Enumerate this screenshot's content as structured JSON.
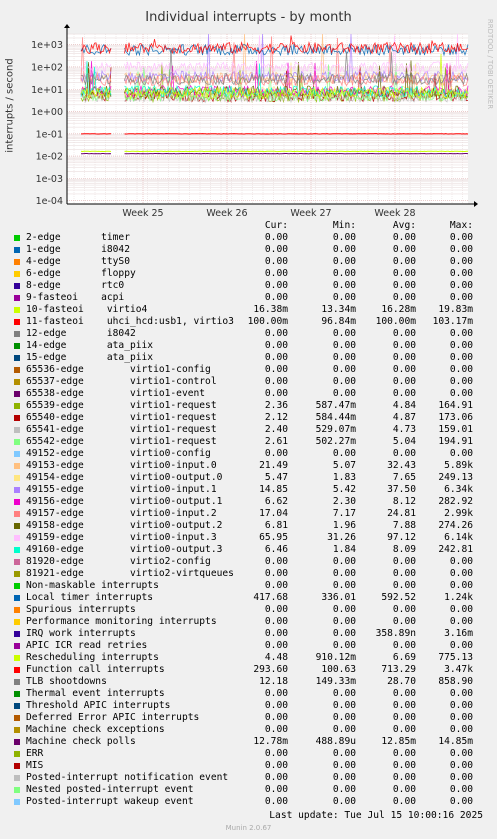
{
  "chart_data": {
    "type": "line",
    "title": "Individual interrupts - by month",
    "ylabel": "interrupts / second",
    "y_scale": "log",
    "ylim": [
      0.0001,
      3000
    ],
    "y_ticks": [
      "1e+03",
      "1e+02",
      "1e+01",
      "1e+00",
      "1e-01",
      "1e-02",
      "1e-03",
      "1e-04"
    ],
    "x_ticks": [
      "Week 25",
      "Week 26",
      "Week 27",
      "Week 28"
    ],
    "grid": true,
    "columns": [
      "Cur:",
      "Min:",
      "Avg:",
      "Max:"
    ],
    "series": [
      {
        "name": "2-edge       timer",
        "color": "#00cc00",
        "cur": "0.00",
        "min": "0.00",
        "avg": "0.00",
        "max": "0.00"
      },
      {
        "name": "1-edge       i8042",
        "color": "#0066b3",
        "cur": "0.00",
        "min": "0.00",
        "avg": "0.00",
        "max": "0.00"
      },
      {
        "name": "4-edge       ttyS0",
        "color": "#ff8000",
        "cur": "0.00",
        "min": "0.00",
        "avg": "0.00",
        "max": "0.00"
      },
      {
        "name": "6-edge       floppy",
        "color": "#ffcc00",
        "cur": "0.00",
        "min": "0.00",
        "avg": "0.00",
        "max": "0.00"
      },
      {
        "name": "8-edge       rtc0",
        "color": "#330099",
        "cur": "0.00",
        "min": "0.00",
        "avg": "0.00",
        "max": "0.00"
      },
      {
        "name": "9-fasteoi    acpi",
        "color": "#990099",
        "cur": "0.00",
        "min": "0.00",
        "avg": "0.00",
        "max": "0.00"
      },
      {
        "name": "10-fasteoi    virtio4",
        "color": "#ccff00",
        "cur": "16.38m",
        "min": "13.34m",
        "avg": "16.28m",
        "max": "19.83m"
      },
      {
        "name": "11-fasteoi    uhci_hcd:usb1, virtio3",
        "color": "#ff0000",
        "cur": "100.00m",
        "min": "96.84m",
        "avg": "100.00m",
        "max": "103.17m"
      },
      {
        "name": "12-edge       i8042",
        "color": "#808080",
        "cur": "0.00",
        "min": "0.00",
        "avg": "0.00",
        "max": "0.00"
      },
      {
        "name": "14-edge       ata_piix",
        "color": "#008f00",
        "cur": "0.00",
        "min": "0.00",
        "avg": "0.00",
        "max": "0.00"
      },
      {
        "name": "15-edge       ata_piix",
        "color": "#00487d",
        "cur": "0.00",
        "min": "0.00",
        "avg": "0.00",
        "max": "0.00"
      },
      {
        "name": "65536-edge        virtio1-config",
        "color": "#b35a00",
        "cur": "0.00",
        "min": "0.00",
        "avg": "0.00",
        "max": "0.00"
      },
      {
        "name": "65537-edge        virtio1-control",
        "color": "#b38f00",
        "cur": "0.00",
        "min": "0.00",
        "avg": "0.00",
        "max": "0.00"
      },
      {
        "name": "65538-edge        virtio1-event",
        "color": "#6b006b",
        "cur": "0.00",
        "min": "0.00",
        "avg": "0.00",
        "max": "0.00"
      },
      {
        "name": "65539-edge        virtio1-request",
        "color": "#8fb300",
        "cur": "2.36",
        "min": "587.47m",
        "avg": "4.84",
        "max": "164.91"
      },
      {
        "name": "65540-edge        virtio1-request",
        "color": "#b30000",
        "cur": "2.12",
        "min": "584.44m",
        "avg": "4.87",
        "max": "173.06"
      },
      {
        "name": "65541-edge        virtio1-request",
        "color": "#bebebe",
        "cur": "2.40",
        "min": "529.07m",
        "avg": "4.73",
        "max": "159.01"
      },
      {
        "name": "65542-edge        virtio1-request",
        "color": "#80ff80",
        "cur": "2.61",
        "min": "502.27m",
        "avg": "5.04",
        "max": "194.91"
      },
      {
        "name": "49152-edge        virtio0-config",
        "color": "#80c9ff",
        "cur": "0.00",
        "min": "0.00",
        "avg": "0.00",
        "max": "0.00"
      },
      {
        "name": "49153-edge        virtio0-input.0",
        "color": "#ffc080",
        "cur": "21.49",
        "min": "5.07",
        "avg": "32.43",
        "max": "5.89k"
      },
      {
        "name": "49154-edge        virtio0-output.0",
        "color": "#ffe680",
        "cur": "5.47",
        "min": "1.83",
        "avg": "7.65",
        "max": "249.13"
      },
      {
        "name": "49155-edge        virtio0-input.1",
        "color": "#aa80ff",
        "cur": "14.85",
        "min": "5.42",
        "avg": "37.50",
        "max": "6.34k"
      },
      {
        "name": "49156-edge        virtio0-output.1",
        "color": "#ee00cc",
        "cur": "6.62",
        "min": "2.30",
        "avg": "8.12",
        "max": "282.92"
      },
      {
        "name": "49157-edge        virtio0-input.2",
        "color": "#ff8080",
        "cur": "17.04",
        "min": "7.17",
        "avg": "24.81",
        "max": "2.99k"
      },
      {
        "name": "49158-edge        virtio0-output.2",
        "color": "#666600",
        "cur": "6.81",
        "min": "1.96",
        "avg": "7.88",
        "max": "274.26"
      },
      {
        "name": "49159-edge        virtio0-input.3",
        "color": "#ffbfff",
        "cur": "65.95",
        "min": "31.26",
        "avg": "97.12",
        "max": "6.14k"
      },
      {
        "name": "49160-edge        virtio0-output.3",
        "color": "#00ffcc",
        "cur": "6.46",
        "min": "1.84",
        "avg": "8.09",
        "max": "242.81"
      },
      {
        "name": "81920-edge        virtio2-config",
        "color": "#cc6699",
        "cur": "0.00",
        "min": "0.00",
        "avg": "0.00",
        "max": "0.00"
      },
      {
        "name": "81921-edge        virtio2-virtqueues",
        "color": "#999900",
        "cur": "0.00",
        "min": "0.00",
        "avg": "0.00",
        "max": "0.00"
      },
      {
        "name": "Non-maskable interrupts",
        "color": "#00cc00",
        "cur": "0.00",
        "min": "0.00",
        "avg": "0.00",
        "max": "0.00"
      },
      {
        "name": "Local timer interrupts",
        "color": "#0066b3",
        "cur": "417.68",
        "min": "336.01",
        "avg": "592.52",
        "max": "1.24k"
      },
      {
        "name": "Spurious interrupts",
        "color": "#ff8000",
        "cur": "0.00",
        "min": "0.00",
        "avg": "0.00",
        "max": "0.00"
      },
      {
        "name": "Performance monitoring interrupts",
        "color": "#ffcc00",
        "cur": "0.00",
        "min": "0.00",
        "avg": "0.00",
        "max": "0.00"
      },
      {
        "name": "IRQ work interrupts",
        "color": "#330099",
        "cur": "0.00",
        "min": "0.00",
        "avg": "358.89n",
        "max": "3.16m"
      },
      {
        "name": "APIC ICR read retries",
        "color": "#990099",
        "cur": "0.00",
        "min": "0.00",
        "avg": "0.00",
        "max": "0.00"
      },
      {
        "name": "Rescheduling interrupts",
        "color": "#ccff00",
        "cur": "4.48",
        "min": "910.12m",
        "avg": "6.69",
        "max": "775.13"
      },
      {
        "name": "Function call interrupts",
        "color": "#ff0000",
        "cur": "293.60",
        "min": "100.63",
        "avg": "713.29",
        "max": "3.47k"
      },
      {
        "name": "TLB shootdowns",
        "color": "#808080",
        "cur": "12.18",
        "min": "149.33m",
        "avg": "28.70",
        "max": "858.90"
      },
      {
        "name": "Thermal event interrupts",
        "color": "#008f00",
        "cur": "0.00",
        "min": "0.00",
        "avg": "0.00",
        "max": "0.00"
      },
      {
        "name": "Threshold APIC interrupts",
        "color": "#00487d",
        "cur": "0.00",
        "min": "0.00",
        "avg": "0.00",
        "max": "0.00"
      },
      {
        "name": "Deferred Error APIC interrupts",
        "color": "#b35a00",
        "cur": "0.00",
        "min": "0.00",
        "avg": "0.00",
        "max": "0.00"
      },
      {
        "name": "Machine check exceptions",
        "color": "#b38f00",
        "cur": "0.00",
        "min": "0.00",
        "avg": "0.00",
        "max": "0.00"
      },
      {
        "name": "Machine check polls",
        "color": "#6b006b",
        "cur": "12.78m",
        "min": "488.89u",
        "avg": "12.85m",
        "max": "14.85m"
      },
      {
        "name": "ERR",
        "color": "#8fb300",
        "cur": "0.00",
        "min": "0.00",
        "avg": "0.00",
        "max": "0.00"
      },
      {
        "name": "MIS",
        "color": "#b30000",
        "cur": "0.00",
        "min": "0.00",
        "avg": "0.00",
        "max": "0.00"
      },
      {
        "name": "Posted-interrupt notification event",
        "color": "#bebebe",
        "cur": "0.00",
        "min": "0.00",
        "avg": "0.00",
        "max": "0.00"
      },
      {
        "name": "Nested posted-interrupt event",
        "color": "#80ff80",
        "cur": "0.00",
        "min": "0.00",
        "avg": "0.00",
        "max": "0.00"
      },
      {
        "name": "Posted-interrupt wakeup event",
        "color": "#80c9ff",
        "cur": "0.00",
        "min": "0.00",
        "avg": "0.00",
        "max": "0.00"
      }
    ],
    "last_update": "Last update: Tue Jul 15 10:00:16 2025",
    "watermark": "RRDTOOL / TOBI OETIKER",
    "footer": "Munin 2.0.67"
  }
}
